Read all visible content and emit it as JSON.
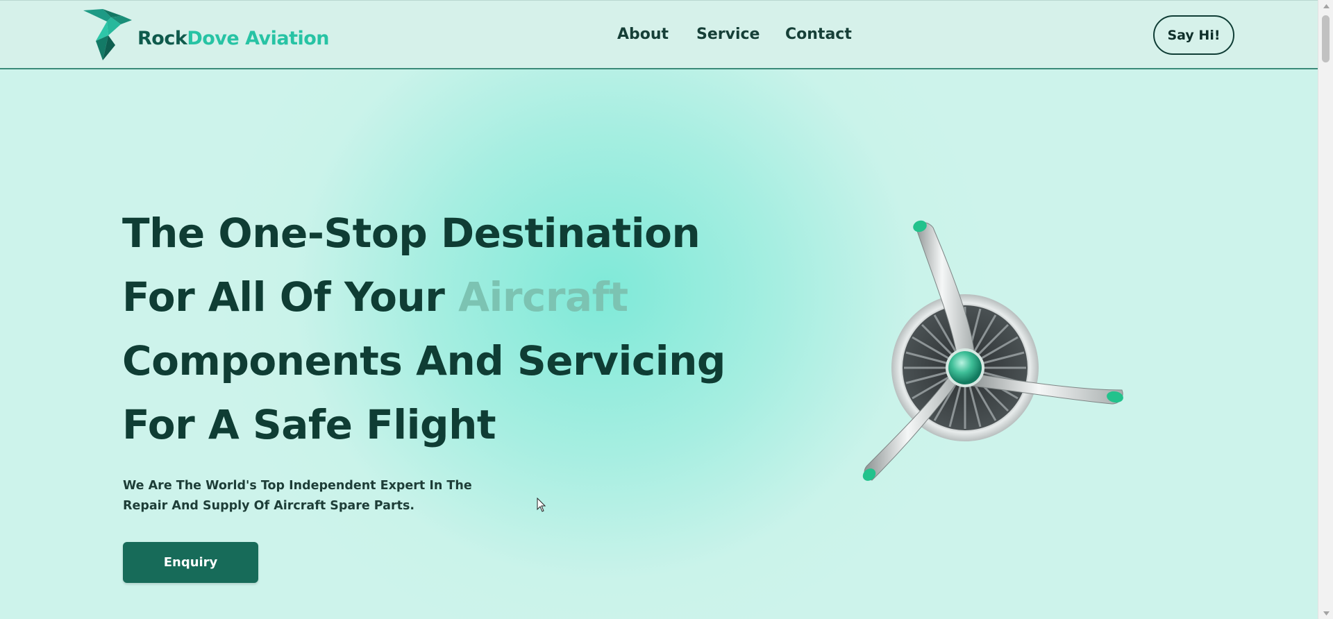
{
  "brand": {
    "name_part1": "Rock",
    "name_part2": "Dove Aviation",
    "colors": {
      "dark": "#0f5a4c",
      "accent": "#27c3a4"
    }
  },
  "nav": {
    "items": [
      {
        "label": "About"
      },
      {
        "label": "Service"
      },
      {
        "label": "Contact"
      }
    ],
    "cta_label": "Say Hi!"
  },
  "hero": {
    "headline": {
      "line1": "The One-Stop Destination",
      "line2_prefix": "For All Of Your ",
      "line2_accent": "Aircraft",
      "line3": "Components And Servicing",
      "line4": "For A Safe Flight"
    },
    "subtext_line1": "We Are The World's Top Independent Expert In The",
    "subtext_line2": "Repair And Supply Of Aircraft Spare Parts.",
    "button_label": "Enquiry",
    "colors": {
      "text": "#0f3d34",
      "accent": "#7cc3b2",
      "button": "#176b59"
    }
  },
  "icons": {
    "logo": "dove-bird-icon",
    "illustration": "jet-engine-propeller-icon",
    "cursor": "mouse-pointer-icon"
  }
}
